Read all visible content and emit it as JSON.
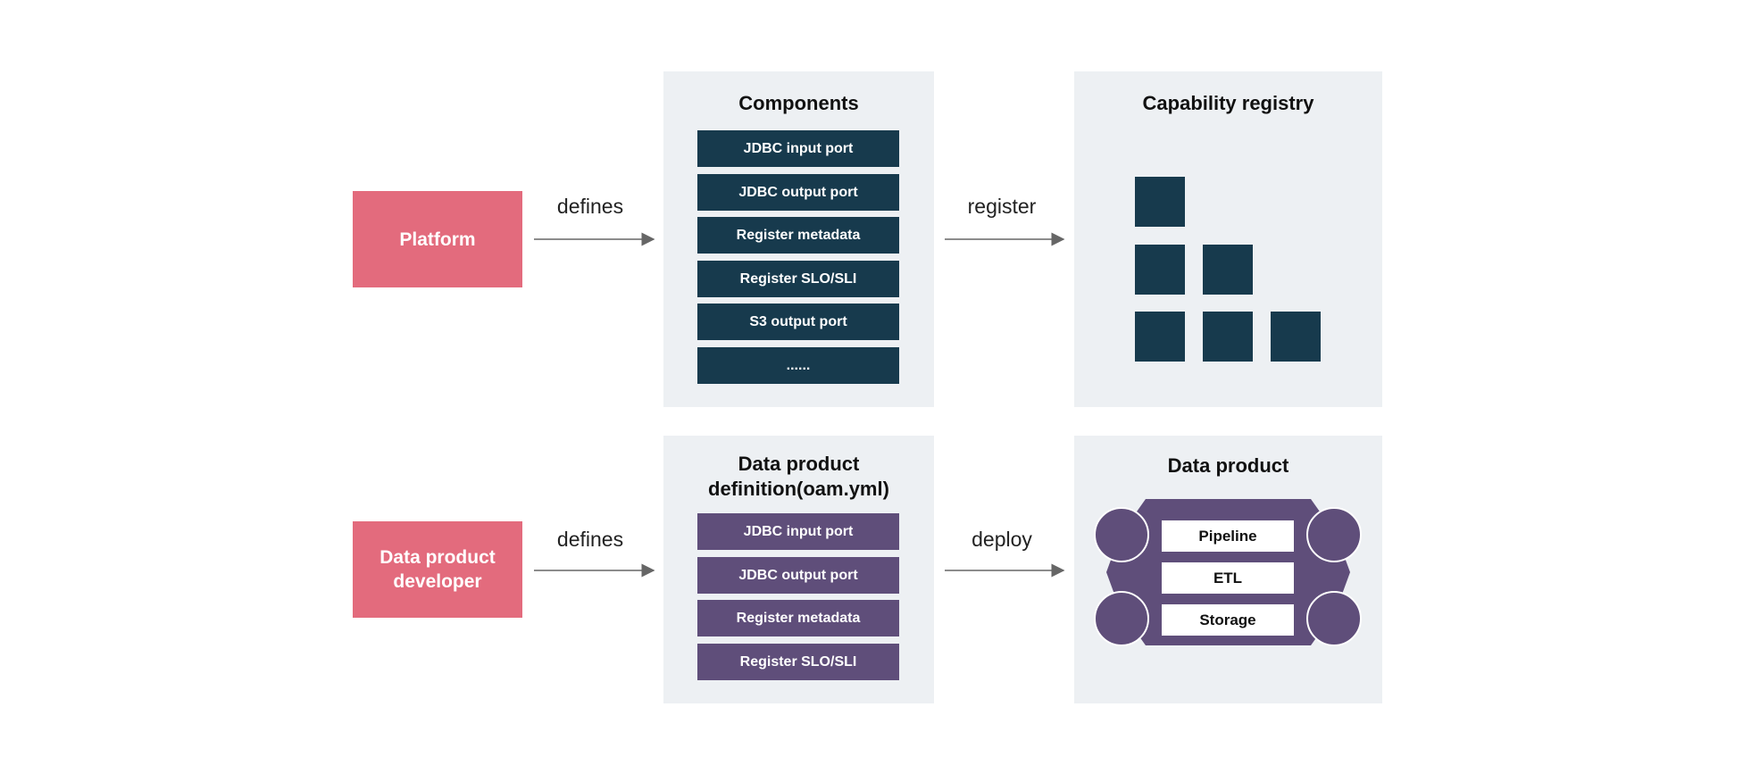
{
  "colors": {
    "actor": "#e36b7d",
    "component": "#173a4d",
    "definition": "#5f4e7a",
    "panel": "#edf0f3"
  },
  "top": {
    "actor": "Platform",
    "arrow1_label": "defines",
    "components_title": "Components",
    "components": [
      "JDBC input port",
      "JDBC output port",
      "Register metadata",
      "Register SLO/SLI",
      "S3 output port",
      "......"
    ],
    "arrow2_label": "register",
    "registry_title": "Capability registry"
  },
  "bottom": {
    "actor": "Data product developer",
    "arrow1_label": "defines",
    "definition_title": "Data product definition(oam.yml)",
    "definition_items": [
      "JDBC input port",
      "JDBC output port",
      "Register metadata",
      "Register SLO/SLI"
    ],
    "arrow2_label": "deploy",
    "product_title": "Data product",
    "product_layers": [
      "Pipeline",
      "ETL",
      "Storage"
    ]
  }
}
